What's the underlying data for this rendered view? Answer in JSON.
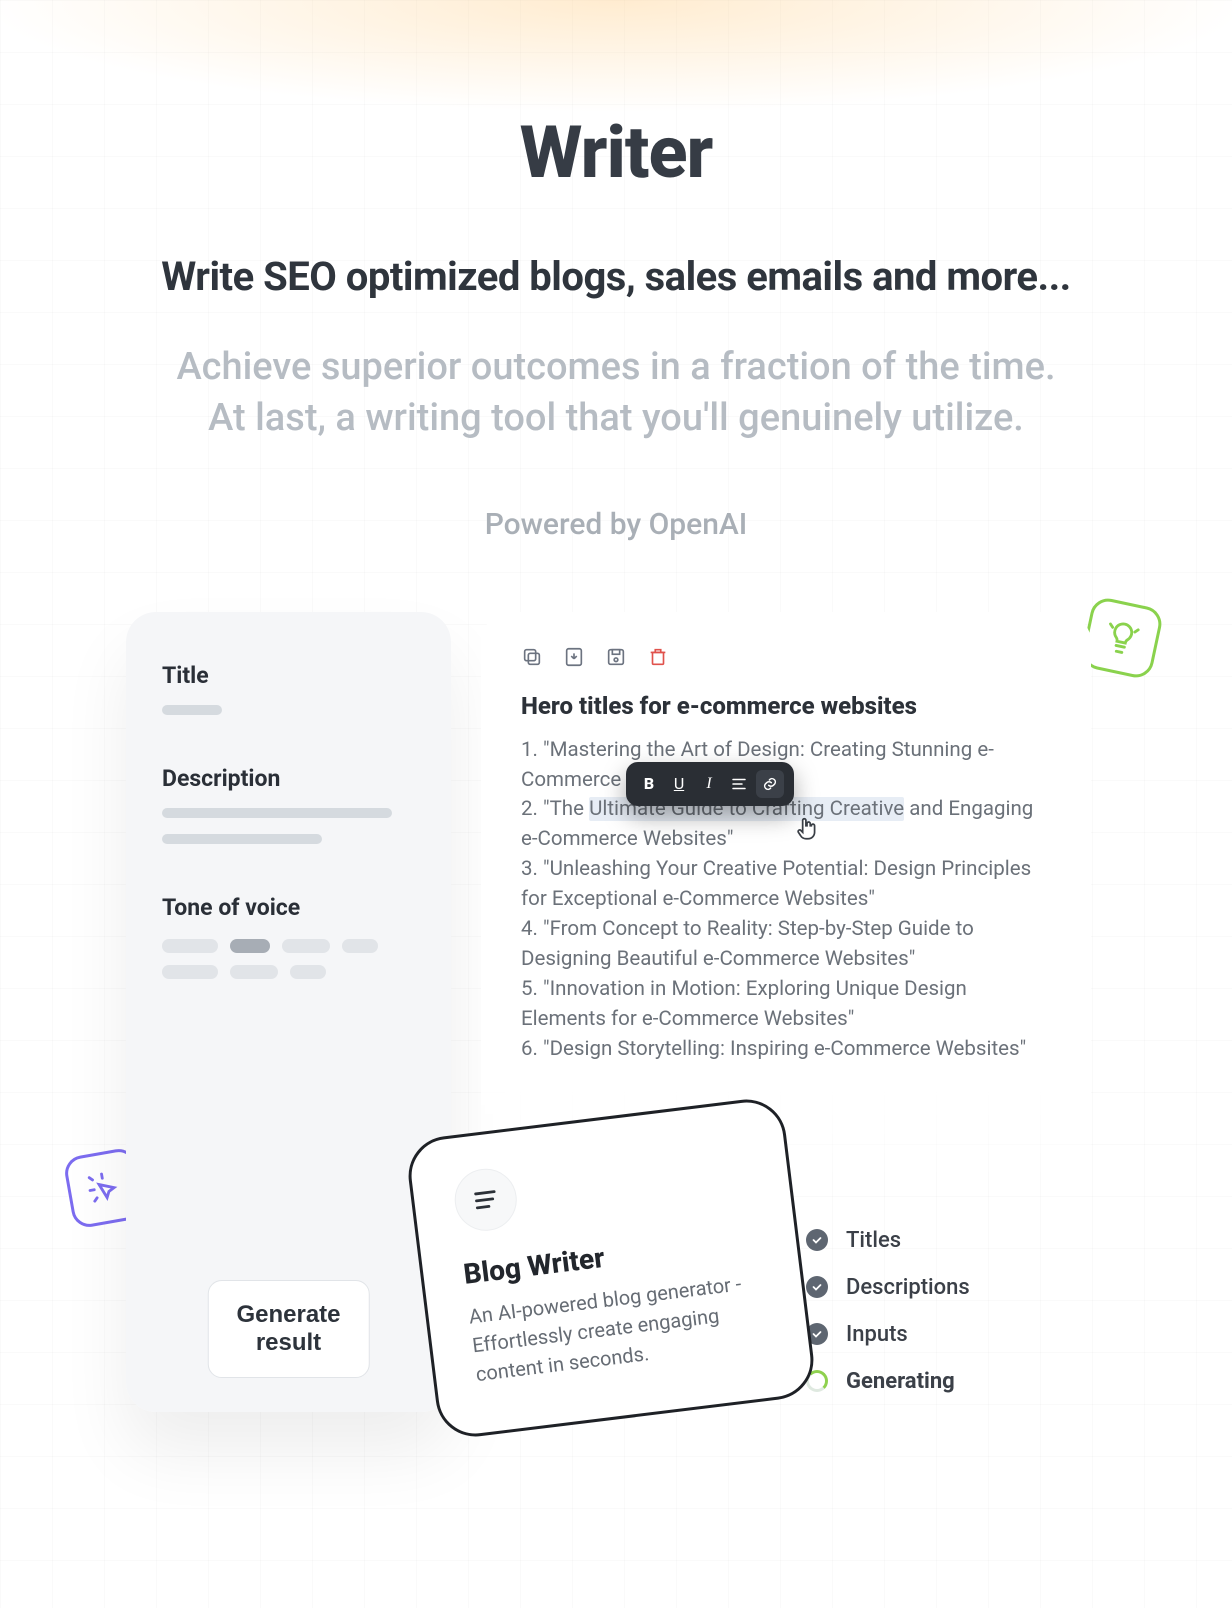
{
  "page": {
    "title": "Writer",
    "subtitle": "Write SEO optimized blogs, sales emails and more...",
    "tagline_line1": "Achieve superior outcomes in a fraction of the time.",
    "tagline_line2": "At last, a writing tool that you'll genuinely utilize.",
    "powered_by": "Powered by OpenAI"
  },
  "form": {
    "title_label": "Title",
    "description_label": "Description",
    "tone_label": "Tone of voice",
    "generate_label": "Generate result"
  },
  "toolbar": {
    "copy": "copy-icon",
    "download": "download-icon",
    "save": "save-icon",
    "delete": "trash-icon"
  },
  "output": {
    "heading": "Hero titles for e-commerce websites",
    "items": [
      "1. \"Mastering the Art of Design: Creating Stunning e-Commerce Websites\"",
      "2. \"The Ultimate Guide to Crafting Creative and Engaging e-Commerce Websites\"",
      "3. \"Unleashing Your Creative Potential: Design Principles for Exceptional e-Commerce Websites\"",
      "4. \"From Concept to Reality: Step-by-Step Guide to Designing Beautiful e-Commerce Websites\"",
      "5. \"Innovation in Motion: Exploring Unique Design Elements for e-Commerce Websites\"",
      "6. \"Design Storytelling: Inspiring e-Commerce Websites\""
    ],
    "highlighted_text": "Ultimate Guide to Crafting Creative"
  },
  "fmt_toolbar": {
    "bold": "B",
    "underline": "U",
    "italic": "I",
    "align": "align-icon",
    "link": "link-icon"
  },
  "tool_card": {
    "title": "Blog Writer",
    "description": "An AI-powered blog generator - Effortlessly create engaging content in seconds."
  },
  "progress": {
    "items": [
      "Titles",
      "Descriptions",
      "Inputs"
    ],
    "active": "Generating"
  },
  "badges": {
    "idea": "lightbulb-icon",
    "click": "cursor-click-icon"
  }
}
